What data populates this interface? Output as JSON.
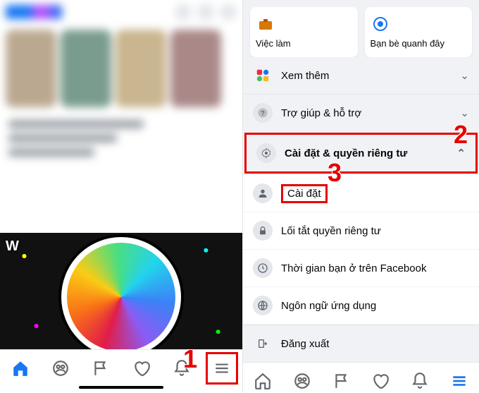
{
  "annotations": {
    "step1": "1",
    "step2": "2",
    "step3": "3"
  },
  "left": {
    "feed_logo": "W"
  },
  "right": {
    "cards": {
      "jobs": {
        "label": "Việc làm"
      },
      "nearby": {
        "label": "Bạn bè quanh đây"
      }
    },
    "see_more": "Xem thêm",
    "help": "Trợ giúp & hỗ trợ",
    "settings_privacy": "Cài đặt & quyền riêng tư",
    "submenu": {
      "settings": "Cài đặt",
      "privacy_shortcuts": "Lối tắt quyền riêng tư",
      "your_time": "Thời gian bạn ở trên Facebook",
      "app_language": "Ngôn ngữ ứng dụng"
    },
    "logout": "Đăng xuất"
  }
}
